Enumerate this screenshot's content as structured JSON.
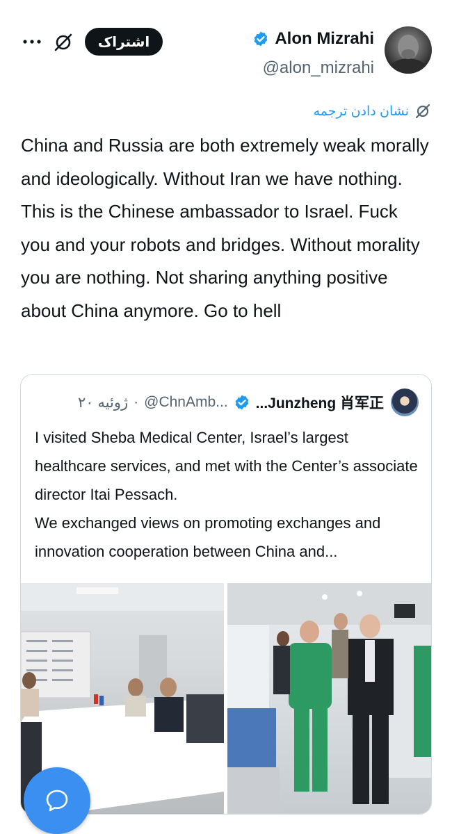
{
  "author": {
    "display_name": "Alon Mizrahi",
    "handle": "@alon_mizrahi",
    "verified": true
  },
  "header": {
    "subscribe_label": "اشتراک",
    "grok_icon": "grok-icon",
    "more_icon": "more-horizontal-icon"
  },
  "translate": {
    "label": "نشان دادن ترجمه",
    "icon": "translate-icon"
  },
  "tweet": {
    "text": "China and Russia are both extremely weak morally and ideologically. Without Iran we have nothing. This is the Chinese ambassador to Israel. Fuck you and your robots and bridges. Without morality you are nothing. Not sharing anything positive about China anymore. Go to hell"
  },
  "quote": {
    "display_name": "...Junzheng 肖军正",
    "handle": "@ChnAmb...",
    "dot": "·",
    "date": "۲۰ ژوئیه",
    "text_line1": "I visited Sheba Medical Center, Israel’s largest healthcare services, and met with the Center’s associate director Itai Pessach.",
    "text_line2": "We exchanged views on promoting exchanges and innovation cooperation between China and...",
    "images": [
      "meeting-room-photo",
      "hospital-corridor-photo"
    ]
  },
  "fab": {
    "icon": "compose-icon"
  },
  "colors": {
    "accent": "#1d9bf0",
    "fab": "#3a8ff0",
    "text": "#0f1419",
    "muted": "#536471"
  }
}
